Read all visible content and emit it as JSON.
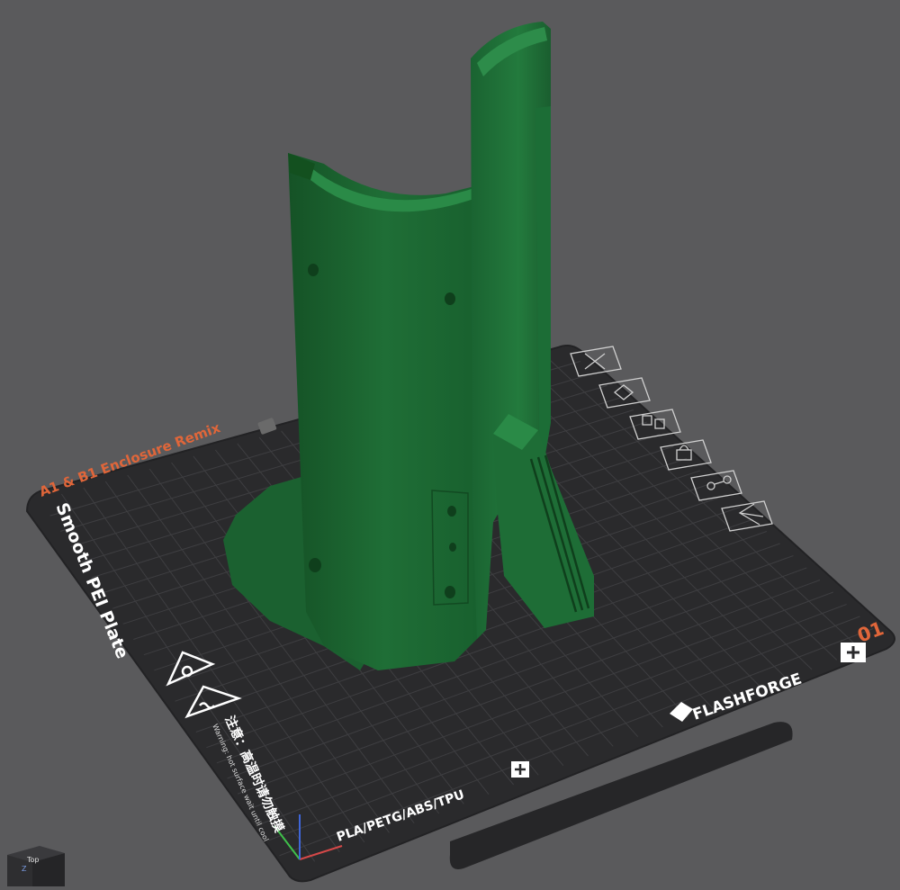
{
  "plate": {
    "project_name": "A1 & B1 Enclosure Remix",
    "plate_type": "Smooth PEI Plate",
    "plate_number": "01",
    "brand": "FLASHFORGE",
    "materials": "PLA/PETG/ABS/TPU",
    "warning_cn": "注意：高温时请勿触摸",
    "warning_en": "Warning: hot surface wait until cool"
  },
  "view_cube": {
    "face_label": "Top",
    "axis_label": "Z"
  },
  "colors": {
    "background": "#5a5a5c",
    "bed": "#2a2a2c",
    "grid": "#3f3f42",
    "model": "#1f6b35",
    "accent": "#e0663a",
    "plate_text": "#ffffff"
  },
  "plate_tools": [
    {
      "icon": "close-icon"
    },
    {
      "icon": "auto-orient-icon"
    },
    {
      "icon": "arrange-icon"
    },
    {
      "icon": "lock-icon"
    },
    {
      "icon": "plate-settings-icon"
    },
    {
      "icon": "back-icon"
    }
  ]
}
